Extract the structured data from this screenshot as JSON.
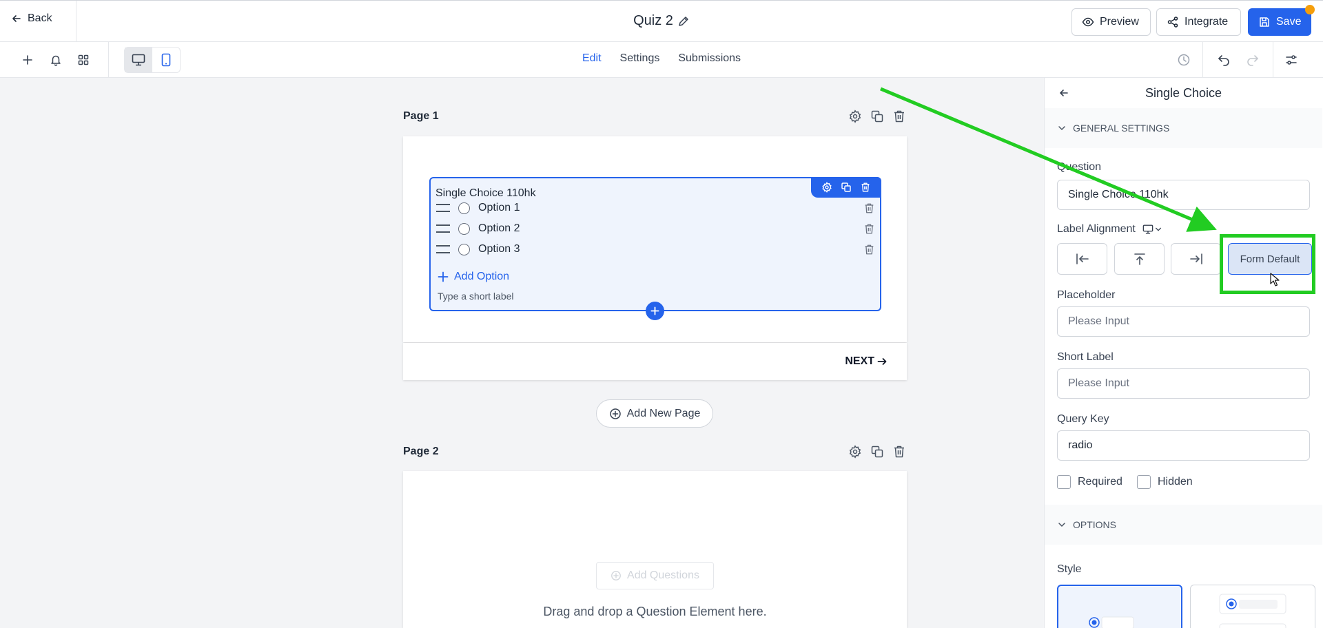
{
  "header": {
    "back_label": "Back",
    "title": "Quiz 2",
    "preview_label": "Preview",
    "integrate_label": "Integrate",
    "save_label": "Save"
  },
  "toolbar": {
    "tabs": [
      {
        "label": "Edit",
        "active": true
      },
      {
        "label": "Settings",
        "active": false
      },
      {
        "label": "Submissions",
        "active": false
      }
    ],
    "left_icons": [
      "plus-icon",
      "bell-icon",
      "grid-icon"
    ],
    "device_icons": [
      "desktop-icon",
      "mobile-icon"
    ],
    "right_icons": [
      "history-icon",
      "undo-icon",
      "redo-icon",
      "sliders-icon"
    ]
  },
  "canvas": {
    "page1": {
      "label": "Page 1",
      "question": {
        "title": "Single Choice 110hk",
        "options": [
          "Option 1",
          "Option 2",
          "Option 3"
        ],
        "add_option_label": "Add Option",
        "short_label_placeholder": "Type a short label"
      },
      "next_label": "NEXT"
    },
    "add_page_label": "Add New Page",
    "page2": {
      "label": "Page 2",
      "add_questions_label": "Add Questions",
      "dropzone_text": "Drag and drop a Question Element here."
    }
  },
  "panel": {
    "title": "Single Choice",
    "general_settings_label": "GENERAL SETTINGS",
    "question_label": "Question",
    "question_value": "Single Choice 110hk",
    "label_alignment_label": "Label Alignment",
    "form_default_label": "Form Default",
    "placeholder_label": "Placeholder",
    "placeholder_placeholder": "Please Input",
    "short_label_label": "Short Label",
    "short_label_placeholder": "Please Input",
    "query_key_label": "Query Key",
    "query_key_value": "radio",
    "required_label": "Required",
    "hidden_label": "Hidden",
    "options_section_label": "OPTIONS",
    "style_label": "Style"
  },
  "colors": {
    "accent": "#2563eb",
    "annotation": "#22cc22",
    "notification_dot": "#f59e0b"
  }
}
